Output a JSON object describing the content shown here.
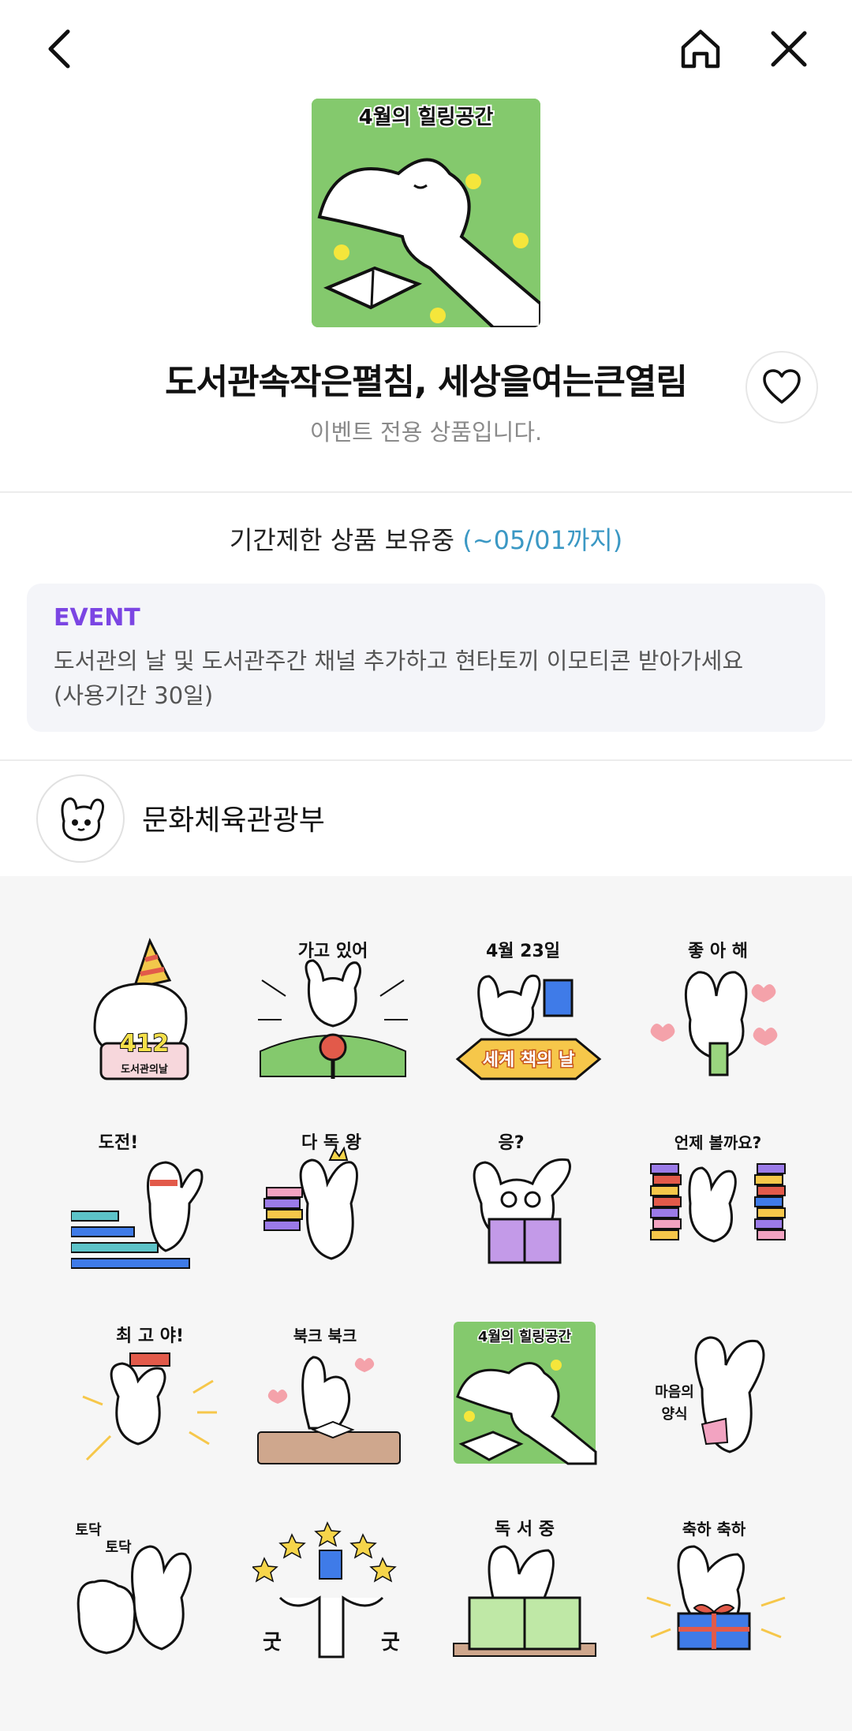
{
  "header": {
    "back_icon": "chevron-left-icon",
    "home_icon": "home-icon",
    "close_icon": "close-icon"
  },
  "hero": {
    "image_caption": "4월의 힐링공간",
    "title": "도서관속작은펼침, 세상을여는큰열림",
    "subtitle": "이벤트 전용 상품입니다."
  },
  "limit": {
    "text": "기간제한 상품 보유중 ",
    "highlight": "(~05/01까지)"
  },
  "event": {
    "tag": "EVENT",
    "line1": "도서관의 날 및 도서관주간 채널 추가하고 현타토끼 이모티콘 받아가세요",
    "line2": "(사용기간 30일)"
  },
  "channel": {
    "name": "문화체육관광부"
  },
  "stickers": [
    {
      "caption": "412",
      "sub": "도서관의날"
    },
    {
      "caption": "가고 있어"
    },
    {
      "caption": "4월 23일",
      "sub": "세계 책의 날"
    },
    {
      "caption": "좋 아 해"
    },
    {
      "caption": "도전!"
    },
    {
      "caption": "다 독 왕"
    },
    {
      "caption": "응?"
    },
    {
      "caption": "언제 볼까요?"
    },
    {
      "caption": "최 고 야!"
    },
    {
      "caption": "북크 북크"
    },
    {
      "caption": "4월의 힐링공간"
    },
    {
      "caption": "마음의",
      "sub": "양식"
    },
    {
      "caption": "토닥",
      "sub": "토닥"
    },
    {
      "caption": "굿",
      "sub": "굿"
    },
    {
      "caption": "독 서 중"
    },
    {
      "caption": "축하 축하"
    }
  ],
  "colors": {
    "accent_purple": "#7b45e3",
    "highlight_blue": "#3b98c4",
    "hero_green": "#84c96d"
  }
}
